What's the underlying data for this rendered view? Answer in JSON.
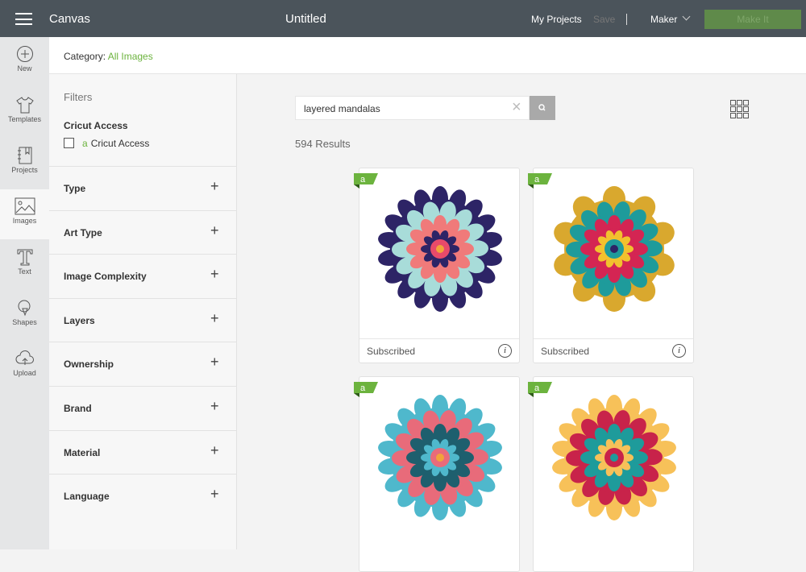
{
  "topbar": {
    "app_name": "Canvas",
    "document_title": "Untitled",
    "my_projects": "My Projects",
    "save": "Save",
    "machine": "Maker",
    "make_it": "Make It"
  },
  "nav": [
    {
      "label": "New",
      "icon": "plus-circle-icon"
    },
    {
      "label": "Templates",
      "icon": "tshirt-icon"
    },
    {
      "label": "Projects",
      "icon": "notebook-icon"
    },
    {
      "label": "Images",
      "icon": "image-icon",
      "active": true
    },
    {
      "label": "Text",
      "icon": "text-icon"
    },
    {
      "label": "Shapes",
      "icon": "shapes-icon"
    },
    {
      "label": "Upload",
      "icon": "upload-cloud-icon"
    }
  ],
  "category": {
    "label": "Category:",
    "value": "All Images"
  },
  "filters": {
    "title": "Filters",
    "access_heading": "Cricut Access",
    "access_option": "Cricut Access",
    "access_checked": false,
    "groups": [
      "Type",
      "Art Type",
      "Image Complexity",
      "Layers",
      "Ownership",
      "Brand",
      "Material",
      "Language"
    ],
    "expand": "+"
  },
  "search": {
    "value": "layered mandalas"
  },
  "results": "594 Results",
  "cards": [
    {
      "status": "Subscribed",
      "info": "i"
    },
    {
      "status": "Subscribed",
      "info": "i"
    },
    {
      "status": "",
      "info": ""
    },
    {
      "status": "",
      "info": ""
    }
  ],
  "colors": {
    "accent": "#6cb33e",
    "topbar": "#4b545b",
    "make_button": "#5f8a4a"
  }
}
